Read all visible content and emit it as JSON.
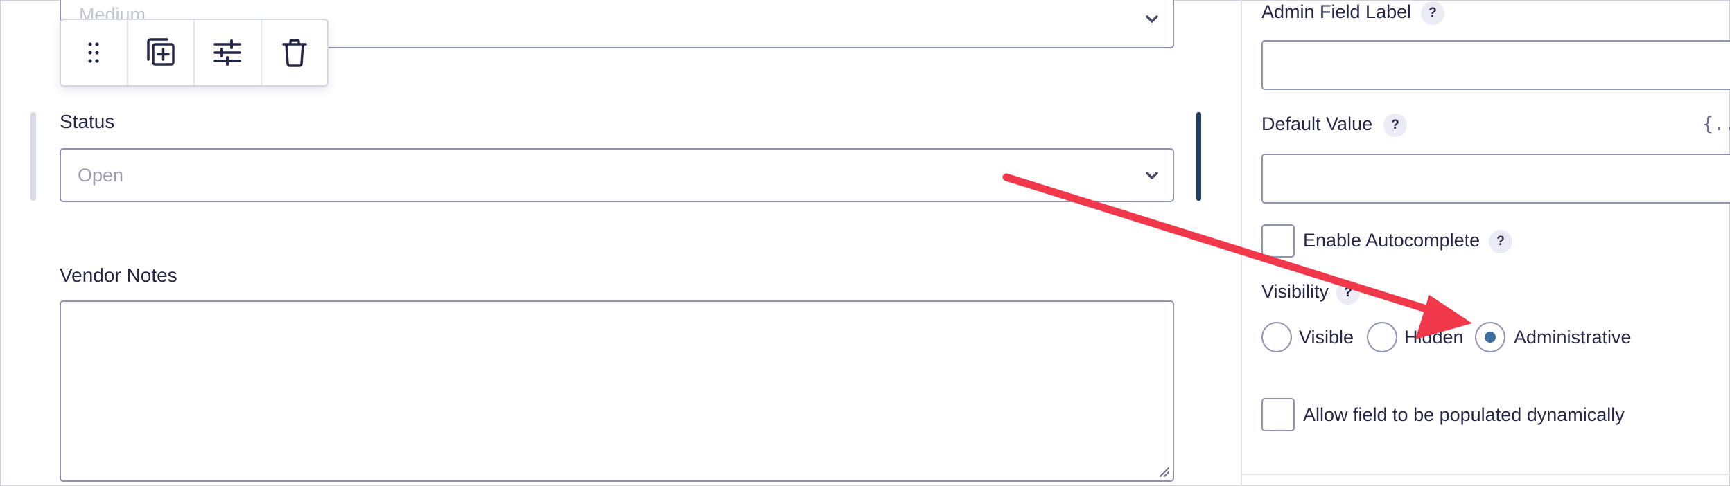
{
  "form": {
    "top_select": {
      "value": "Medium"
    },
    "status": {
      "label": "Status",
      "placeholder": "Open"
    },
    "vendor_notes": {
      "label": "Vendor Notes",
      "value": ""
    }
  },
  "toolbar": {
    "items": [
      {
        "name": "drag",
        "icon": "drag-handle-icon"
      },
      {
        "name": "duplicate",
        "icon": "duplicate-icon"
      },
      {
        "name": "settings",
        "icon": "sliders-icon"
      },
      {
        "name": "delete",
        "icon": "trash-icon"
      }
    ]
  },
  "settings": {
    "admin_field_label": {
      "label": "Admin Field Label",
      "help": "?",
      "value": ""
    },
    "default_value": {
      "label": "Default Value",
      "help": "?",
      "merge_tag": "{..}",
      "value": ""
    },
    "enable_autocomplete": {
      "label": "Enable Autocomplete",
      "help": "?",
      "checked": false
    },
    "visibility": {
      "label": "Visibility",
      "help": "?",
      "options": [
        {
          "label": "Visible",
          "selected": false
        },
        {
          "label": "Hidden",
          "selected": false
        },
        {
          "label": "Administrative",
          "selected": true
        }
      ]
    },
    "allow_dynamic": {
      "label": "Allow field to be populated dynamically",
      "checked": false
    }
  },
  "annotation": {
    "color": "#f0384a",
    "icon": "arrow-annotation"
  },
  "colors": {
    "accent_bar": "#1e3f63",
    "border": "#9092b2",
    "radio_dot": "#3d6f9f"
  }
}
